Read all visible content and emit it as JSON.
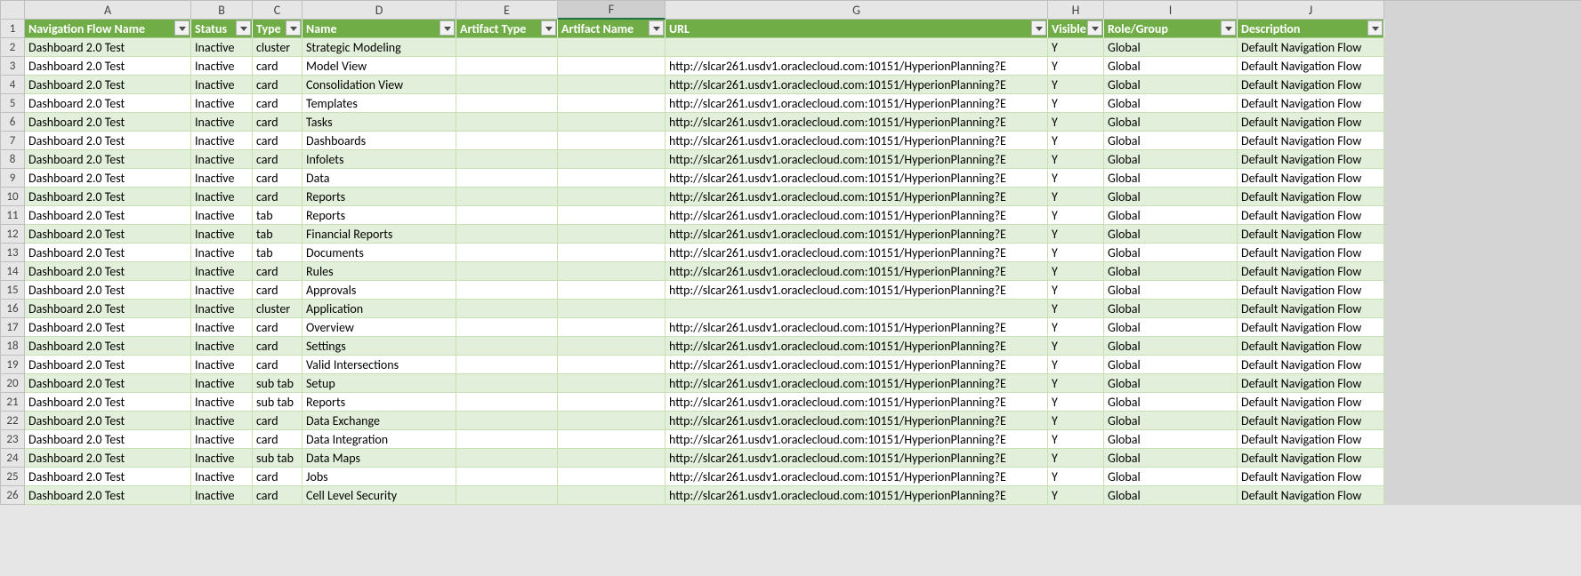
{
  "columns": [
    "A",
    "B",
    "C",
    "D",
    "E",
    "F",
    "G",
    "H",
    "I",
    "J"
  ],
  "headers": [
    "Navigation Flow Name",
    "Status",
    "Type",
    "Name",
    "Artifact Type",
    "Artifact Name",
    "URL",
    "Visible",
    "Role/Group",
    "Description"
  ],
  "selectedCol": "F",
  "url": "http://slcar261.usdv1.oraclecloud.com:10151/HyperionPlanning?E",
  "rows": [
    {
      "a": "Dashboard 2.0 Test",
      "b": "Inactive",
      "c": "cluster",
      "d": "Strategic Modeling",
      "e": "",
      "f": "",
      "g": "",
      "h": "Y",
      "i": "Global",
      "j": "Default Navigation Flow"
    },
    {
      "a": "Dashboard 2.0 Test",
      "b": "Inactive",
      "c": "card",
      "d": "Model View",
      "e": "",
      "f": "",
      "g": "@url",
      "h": "Y",
      "i": "Global",
      "j": "Default Navigation Flow"
    },
    {
      "a": "Dashboard 2.0 Test",
      "b": "Inactive",
      "c": "card",
      "d": "Consolidation View",
      "e": "",
      "f": "",
      "g": "@url",
      "h": "Y",
      "i": "Global",
      "j": "Default Navigation Flow"
    },
    {
      "a": "Dashboard 2.0 Test",
      "b": "Inactive",
      "c": "card",
      "d": "Templates",
      "e": "",
      "f": "",
      "g": "@url",
      "h": "Y",
      "i": "Global",
      "j": "Default Navigation Flow"
    },
    {
      "a": "Dashboard 2.0 Test",
      "b": "Inactive",
      "c": "card",
      "d": "Tasks",
      "e": "",
      "f": "",
      "g": "@url",
      "h": "Y",
      "i": "Global",
      "j": "Default Navigation Flow"
    },
    {
      "a": "Dashboard 2.0 Test",
      "b": "Inactive",
      "c": "card",
      "d": "Dashboards",
      "e": "",
      "f": "",
      "g": "@url",
      "h": "Y",
      "i": "Global",
      "j": "Default Navigation Flow"
    },
    {
      "a": "Dashboard 2.0 Test",
      "b": "Inactive",
      "c": "card",
      "d": "Infolets",
      "e": "",
      "f": "",
      "g": "@url",
      "h": "Y",
      "i": "Global",
      "j": "Default Navigation Flow"
    },
    {
      "a": "Dashboard 2.0 Test",
      "b": "Inactive",
      "c": "card",
      "d": "Data",
      "e": "",
      "f": "",
      "g": "@url",
      "h": "Y",
      "i": "Global",
      "j": "Default Navigation Flow"
    },
    {
      "a": "Dashboard 2.0 Test",
      "b": "Inactive",
      "c": "card",
      "d": "Reports",
      "e": "",
      "f": "",
      "g": "@url",
      "h": "Y",
      "i": "Global",
      "j": "Default Navigation Flow"
    },
    {
      "a": "Dashboard 2.0 Test",
      "b": "Inactive",
      "c": "tab",
      "d": "Reports",
      "e": "",
      "f": "",
      "g": "@url",
      "h": "Y",
      "i": "Global",
      "j": "Default Navigation Flow"
    },
    {
      "a": "Dashboard 2.0 Test",
      "b": "Inactive",
      "c": "tab",
      "d": "Financial Reports",
      "e": "",
      "f": "",
      "g": "@url",
      "h": "Y",
      "i": "Global",
      "j": "Default Navigation Flow"
    },
    {
      "a": "Dashboard 2.0 Test",
      "b": "Inactive",
      "c": "tab",
      "d": "Documents",
      "e": "",
      "f": "",
      "g": "@url",
      "h": "Y",
      "i": "Global",
      "j": "Default Navigation Flow"
    },
    {
      "a": "Dashboard 2.0 Test",
      "b": "Inactive",
      "c": "card",
      "d": "Rules",
      "e": "",
      "f": "",
      "g": "@url",
      "h": "Y",
      "i": "Global",
      "j": "Default Navigation Flow"
    },
    {
      "a": "Dashboard 2.0 Test",
      "b": "Inactive",
      "c": "card",
      "d": "Approvals",
      "e": "",
      "f": "",
      "g": "@url",
      "h": "Y",
      "i": "Global",
      "j": "Default Navigation Flow"
    },
    {
      "a": "Dashboard 2.0 Test",
      "b": "Inactive",
      "c": "cluster",
      "d": "Application",
      "e": "",
      "f": "",
      "g": "",
      "h": "Y",
      "i": "Global",
      "j": "Default Navigation Flow"
    },
    {
      "a": "Dashboard 2.0 Test",
      "b": "Inactive",
      "c": "card",
      "d": "Overview",
      "e": "",
      "f": "",
      "g": "@url",
      "h": "Y",
      "i": "Global",
      "j": "Default Navigation Flow"
    },
    {
      "a": "Dashboard 2.0 Test",
      "b": "Inactive",
      "c": "card",
      "d": "Settings",
      "e": "",
      "f": "",
      "g": "@url",
      "h": "Y",
      "i": "Global",
      "j": "Default Navigation Flow"
    },
    {
      "a": "Dashboard 2.0 Test",
      "b": "Inactive",
      "c": "card",
      "d": "Valid Intersections",
      "e": "",
      "f": "",
      "g": "@url",
      "h": "Y",
      "i": "Global",
      "j": "Default Navigation Flow"
    },
    {
      "a": "Dashboard 2.0 Test",
      "b": "Inactive",
      "c": "sub tab",
      "d": "Setup",
      "e": "",
      "f": "",
      "g": "@url",
      "h": "Y",
      "i": "Global",
      "j": "Default Navigation Flow"
    },
    {
      "a": "Dashboard 2.0 Test",
      "b": "Inactive",
      "c": "sub tab",
      "d": "Reports",
      "e": "",
      "f": "",
      "g": "@url",
      "h": "Y",
      "i": "Global",
      "j": "Default Navigation Flow"
    },
    {
      "a": "Dashboard 2.0 Test",
      "b": "Inactive",
      "c": "card",
      "d": "Data Exchange",
      "e": "",
      "f": "",
      "g": "@url",
      "h": "Y",
      "i": "Global",
      "j": "Default Navigation Flow"
    },
    {
      "a": "Dashboard 2.0 Test",
      "b": "Inactive",
      "c": "card",
      "d": "Data Integration",
      "e": "",
      "f": "",
      "g": "@url",
      "h": "Y",
      "i": "Global",
      "j": "Default Navigation Flow"
    },
    {
      "a": "Dashboard 2.0 Test",
      "b": "Inactive",
      "c": "sub tab",
      "d": "Data Maps",
      "e": "",
      "f": "",
      "g": "@url",
      "h": "Y",
      "i": "Global",
      "j": "Default Navigation Flow"
    },
    {
      "a": "Dashboard 2.0 Test",
      "b": "Inactive",
      "c": "card",
      "d": "Jobs",
      "e": "",
      "f": "",
      "g": "@url",
      "h": "Y",
      "i": "Global",
      "j": "Default Navigation Flow"
    },
    {
      "a": "Dashboard 2.0 Test",
      "b": "Inactive",
      "c": "card",
      "d": "Cell Level Security",
      "e": "",
      "f": "",
      "g": "@url",
      "h": "Y",
      "i": "Global",
      "j": "Default Navigation Flow"
    }
  ]
}
